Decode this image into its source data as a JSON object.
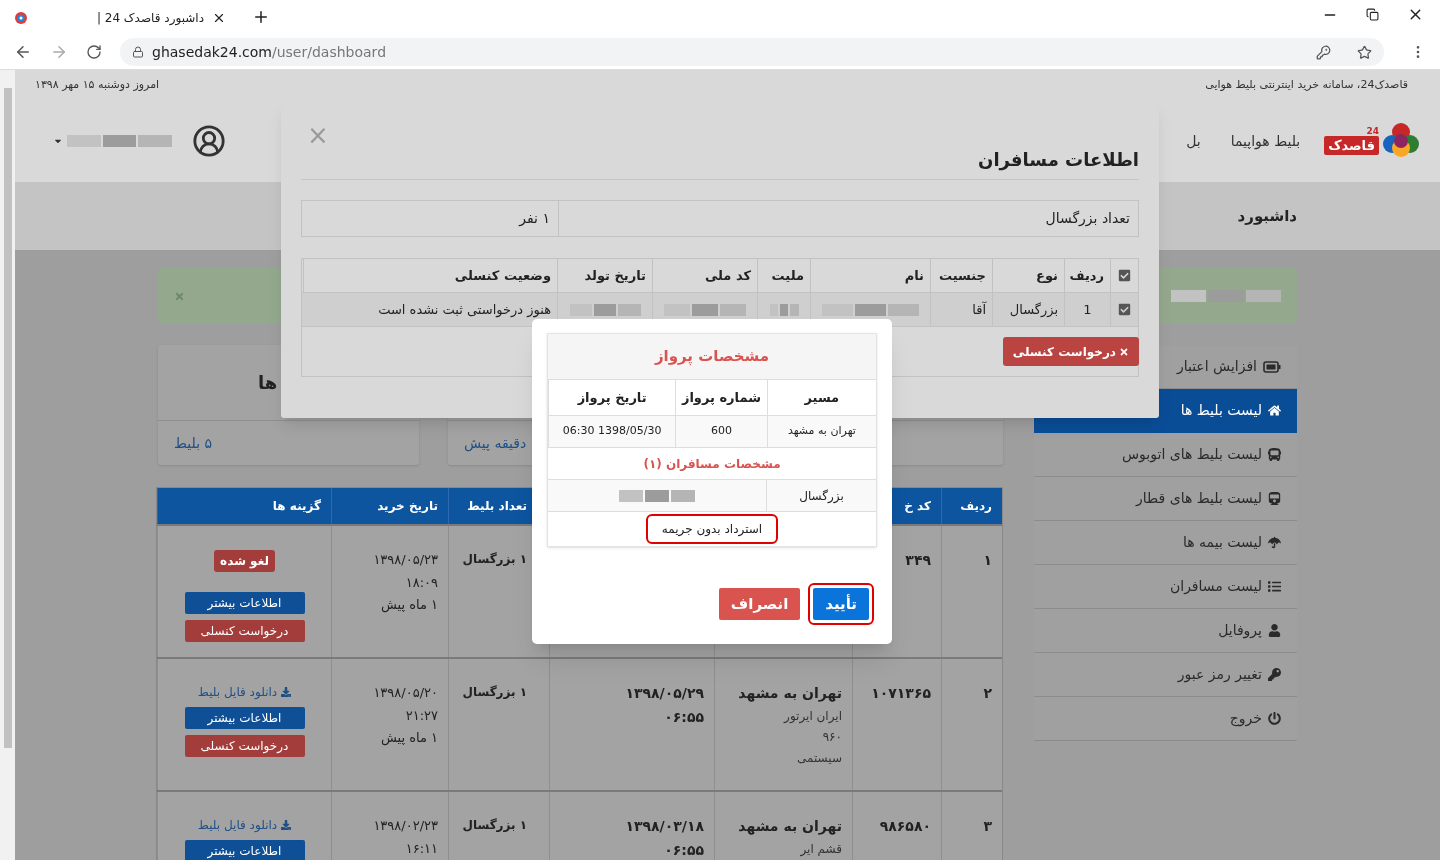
{
  "browser": {
    "tab_title": "داشبورد قاصدک 24 |",
    "url_host": "ghasedak24.com",
    "url_path": "/user/dashboard"
  },
  "topbar": {
    "tagline": "قاصدک24، سامانه خرید اینترنتی بلیط هوایی",
    "date": "امروز دوشنبه ۱۵ مهر ۱۳۹۸"
  },
  "header": {
    "logo_text": "قاصدک",
    "logo_badge": "24",
    "nav": [
      "بلیط هواپیما",
      "بل"
    ]
  },
  "page_title": "داشبورد",
  "sidebar": [
    {
      "label": "افزایش اعتبار",
      "selected": false
    },
    {
      "label": "لیست بلیط ها",
      "selected": true
    },
    {
      "label": "لیست بلیط های اتوبوس",
      "selected": false
    },
    {
      "label": "لیست بلیط های قطار",
      "selected": false
    },
    {
      "label": "لیست بیمه ها",
      "selected": false
    },
    {
      "label": "لیست مسافران",
      "selected": false
    },
    {
      "label": "پروفایل",
      "selected": false
    },
    {
      "label": "تغییر رمز عبور",
      "selected": false
    },
    {
      "label": "خروج",
      "selected": false
    }
  ],
  "cards": [
    {
      "footer": "دقیقه پیش"
    },
    {
      "heading": "ها",
      "footer": "۵ بلیط"
    }
  ],
  "tickets": {
    "columns": [
      "ردیف",
      "کد خ",
      "تعداد بلیط",
      "تاریخ خرید",
      "گزینه ها"
    ],
    "rows": [
      {
        "row": "۱",
        "code": "۳۴۹",
        "count": "۱ بزرگسال",
        "purchase": [
          "۱۳۹۸/۰۵/۲۳",
          "۱۸:۰۹",
          "۱ ماه پیش"
        ],
        "options": [
          {
            "kind": "badge",
            "label": "لغو شده"
          },
          {
            "kind": "info",
            "label": "اطلاعات بیشتر"
          },
          {
            "kind": "cancel",
            "label": "درخواست کنسلی"
          }
        ]
      },
      {
        "row": "۲",
        "code": "۱۰۷۱۳۶۵",
        "route": {
          "title": "تهران به مشهد",
          "details": [
            "ایران ایرتور",
            "۹۶۰",
            "سیستمی"
          ]
        },
        "flight_date": [
          "۱۳۹۸/۰۵/۲۹",
          "۰۶:۵۵"
        ],
        "count": "۱ بزرگسال",
        "purchase": [
          "۱۳۹۸/۰۵/۲۰",
          "۲۱:۲۷",
          "۱ ماه پیش"
        ],
        "options": [
          {
            "kind": "download",
            "label": "دانلود فایل بلیط"
          },
          {
            "kind": "info",
            "label": "اطلاعات بیشتر"
          },
          {
            "kind": "cancel",
            "label": "درخواست کنسلی"
          }
        ]
      },
      {
        "row": "۳",
        "code": "۹۸۶۵۸۰",
        "route": {
          "title": "تهران به مشهد",
          "details": [
            "قشم ایر"
          ]
        },
        "flight_date": [
          "۱۳۹۸/۰۳/۱۸",
          "۰۶:۵۵"
        ],
        "count": "۱ بزرگسال",
        "purchase": [
          "۱۳۹۸/۰۲/۲۳",
          "۱۶:۱۱"
        ],
        "options": [
          {
            "kind": "download",
            "label": "دانلود فایل بلیط"
          },
          {
            "kind": "info",
            "label": "اطلاعات بیشتر"
          }
        ]
      }
    ]
  },
  "passengers_modal": {
    "title": "اطلاعات مسافران",
    "close": "×",
    "summary": {
      "label": "تعداد بزرگسال",
      "value": "۱ نفر"
    },
    "columns": [
      "ردیف",
      "نوع",
      "جنسیت",
      "نام",
      "ملیت",
      "کد ملی",
      "تاریخ تولد",
      "وضعیت کنسلی"
    ],
    "header_checked": true,
    "passengers": [
      {
        "checked": true,
        "row": "1",
        "type": "بزرگسال",
        "gender": "آقا",
        "status": "هنوز درخواستی ثبت نشده است"
      }
    ],
    "cancel_button": "درخواست کنسلی"
  },
  "confirm_dialog": {
    "title": "مشخصات پرواز",
    "columns": [
      "مسیر",
      "شماره پرواز",
      "تاریخ پرواز"
    ],
    "flight": [
      "تهران به مشهد",
      "600",
      "06:30 1398/05/30"
    ],
    "passengers_title": "مشخصات مسافران (۱)",
    "passengers": [
      {
        "type": "بزرگسال"
      }
    ],
    "refund_note": "استرداد بدون جریمه",
    "buttons": [
      {
        "kind": "confirm",
        "label": "تأیید"
      },
      {
        "kind": "cancel",
        "label": "انصراف"
      }
    ]
  }
}
